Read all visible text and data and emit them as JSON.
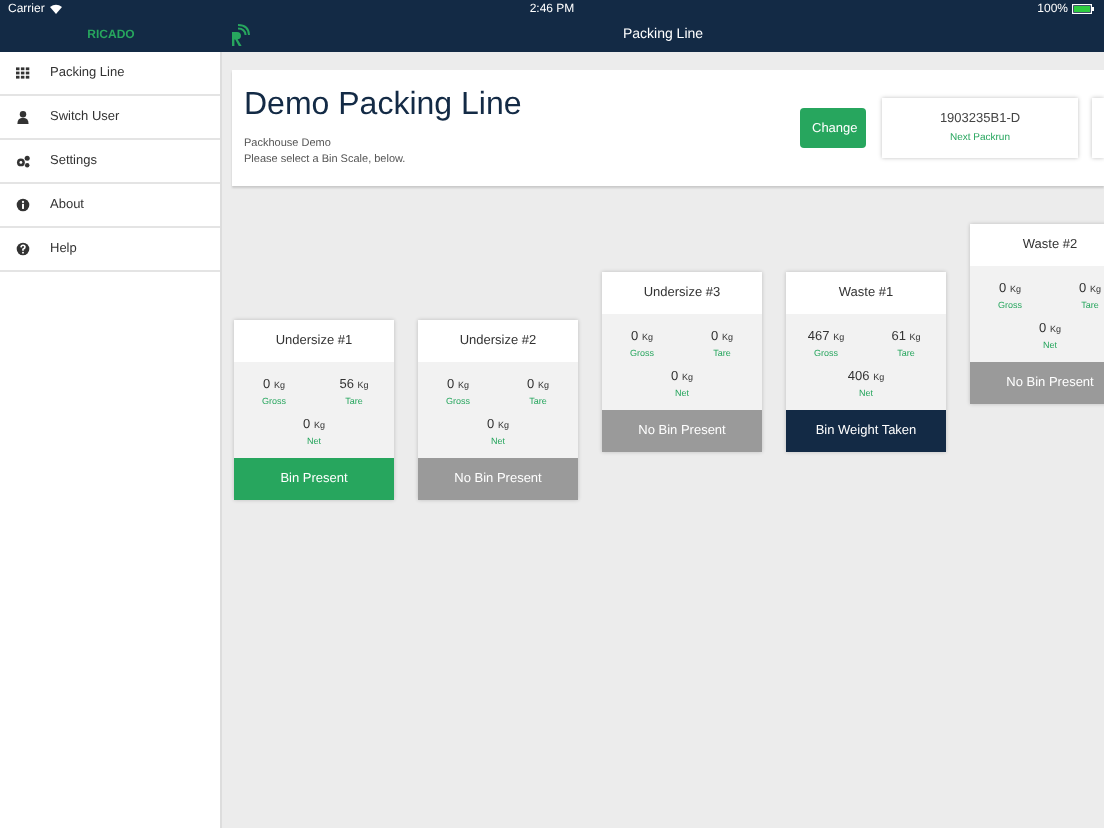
{
  "status_bar": {
    "carrier": "Carrier",
    "time": "2:46 PM",
    "battery": "100%"
  },
  "sidebar": {
    "logo": "RICADO",
    "items": [
      {
        "label": "Packing Line"
      },
      {
        "label": "Switch User"
      },
      {
        "label": "Settings"
      },
      {
        "label": "About"
      },
      {
        "label": "Help"
      }
    ]
  },
  "nav_bar": {
    "title": "Packing Line"
  },
  "header": {
    "title": "Demo Packing Line",
    "subtitle": "Packhouse Demo",
    "instruction": "Please select a Bin Scale, below.",
    "change_button": "Change",
    "packrun": {
      "number": "1903235B1-D",
      "label": "Next Packrun"
    }
  },
  "bin_scales": [
    {
      "name": "Undersize #1",
      "gross": "0",
      "gross_unit": "Kg",
      "tare": "56",
      "tare_unit": "Kg",
      "net": "0",
      "net_unit": "Kg",
      "gross_label": "Gross",
      "tare_label": "Tare",
      "net_label": "Net",
      "kind": "present",
      "status_text": "Bin Present"
    },
    {
      "name": "Undersize #2",
      "gross": "0",
      "gross_unit": "Kg",
      "tare": "0",
      "tare_unit": "Kg",
      "net": "0",
      "net_unit": "Kg",
      "gross_label": "Gross",
      "tare_label": "Tare",
      "net_label": "Net",
      "kind": "none",
      "status_text": "No Bin Present"
    },
    {
      "name": "Undersize #3",
      "gross": "0",
      "gross_unit": "Kg",
      "tare": "0",
      "tare_unit": "Kg",
      "net": "0",
      "net_unit": "Kg",
      "gross_label": "Gross",
      "tare_label": "Tare",
      "net_label": "Net",
      "kind": "none",
      "status_text": "No Bin Present"
    },
    {
      "name": "Waste #1",
      "gross": "467",
      "gross_unit": "Kg",
      "tare": "61",
      "tare_unit": "Kg",
      "net": "406",
      "net_unit": "Kg",
      "gross_label": "Gross",
      "tare_label": "Tare",
      "net_label": "Net",
      "kind": "taken",
      "status_text": "Bin Weight Taken"
    },
    {
      "name": "Waste #2",
      "gross": "0",
      "gross_unit": "Kg",
      "tare": "0",
      "tare_unit": "Kg",
      "net": "0",
      "net_unit": "Kg",
      "gross_label": "Gross",
      "tare_label": "Tare",
      "net_label": "Net",
      "kind": "none",
      "status_text": "No Bin Present"
    }
  ]
}
